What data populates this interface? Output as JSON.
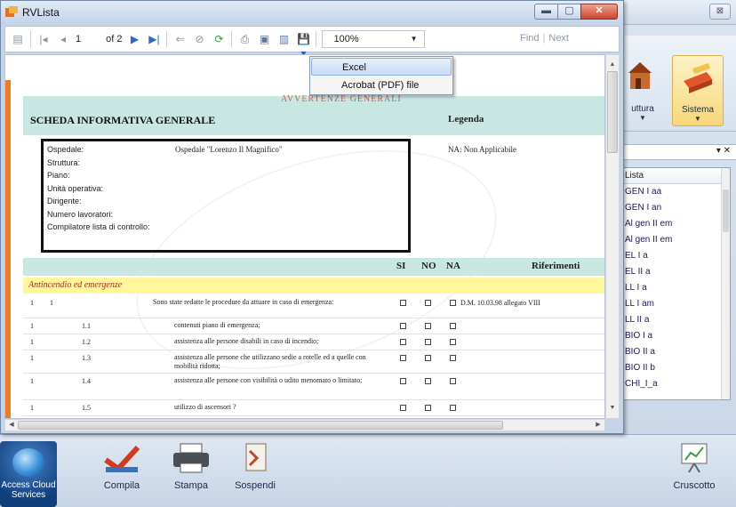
{
  "window": {
    "title": "RVLista"
  },
  "toolbar": {
    "page_current": "1",
    "page_of": "of 2",
    "zoom": "100%",
    "find": "Find",
    "next": "Next"
  },
  "export_menu": {
    "items": [
      "Excel",
      "Acrobat (PDF) file"
    ]
  },
  "report": {
    "stamp": "AVVERTENZE GENERALI",
    "title": "SCHEDA INFORMATIVA GENERALE",
    "legend_title": "Legenda",
    "legend_na": "NA: Non Applicabile",
    "fields": [
      {
        "label": "Ospedale:",
        "value": "Ospedale \"Lorenzo Il Magnifico\""
      },
      {
        "label": "Struttura:",
        "value": ""
      },
      {
        "label": "Piano:",
        "value": ""
      },
      {
        "label": "Unità operativa:",
        "value": ""
      },
      {
        "label": "Dirigente:",
        "value": ""
      },
      {
        "label": "Numero lavoratori:",
        "value": ""
      },
      {
        "label": "Compilatore lista di controllo:",
        "value": ""
      }
    ],
    "columns": {
      "si": "SI",
      "no": "NO",
      "na": "NA",
      "ref": "Riferimenti"
    },
    "category": "Antincendio ed emergenze",
    "rows": [
      {
        "c1": "1",
        "c2": "1",
        "c3": "",
        "text": "Sono state redatte le procedure da attuare in caso di emergenza:",
        "ref": "D.M. 10.03.98 allegato VIII"
      },
      {
        "c1": "1",
        "c2": "",
        "c3": "1.1",
        "text": "contenuti piano di emergenza;",
        "ref": ""
      },
      {
        "c1": "1",
        "c2": "",
        "c3": "1.2",
        "text": "assistenza alle persone disabili in caso di incendio;",
        "ref": ""
      },
      {
        "c1": "1",
        "c2": "",
        "c3": "1.3",
        "text": "assistenza alle persone che utilizzano sedie a rotelle ed a quelle con mobilità ridotta;",
        "ref": ""
      },
      {
        "c1": "1",
        "c2": "",
        "c3": "1.4",
        "text": "assistenza alle persone con visibilità o udito menomato o limitato;",
        "ref": ""
      },
      {
        "c1": "1",
        "c2": "",
        "c3": "1.5",
        "text": "utilizzo di ascensori ?",
        "ref": ""
      }
    ]
  },
  "ribbon": {
    "items": [
      {
        "label": "uttura"
      },
      {
        "label": "Sistema"
      }
    ]
  },
  "side_list": {
    "header": "Lista",
    "items": [
      "GEN I aa",
      "GEN I an",
      "Al gen II em",
      "Al gen II em",
      "EL I a",
      "EL II a",
      "LL I a",
      "LL I am",
      "LL II a",
      "BIO I a",
      "BIO II a",
      "BIO II b",
      "CHI_I_a"
    ]
  },
  "bottom": {
    "cloud": "Access Cloud Services",
    "compila": "Compila",
    "stampa": "Stampa",
    "sospendi": "Sospendi",
    "cruscotto": "Cruscotto"
  }
}
